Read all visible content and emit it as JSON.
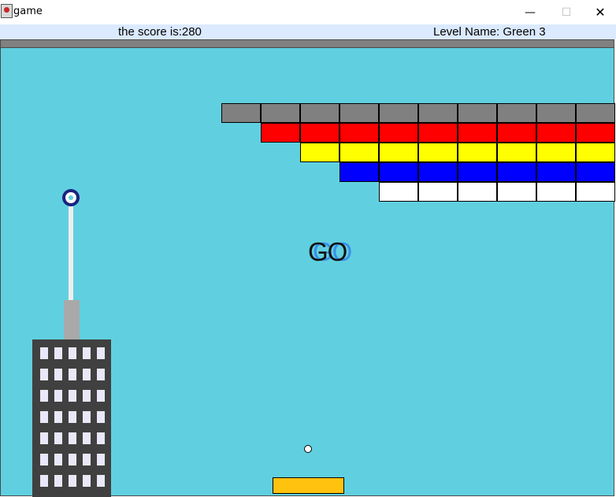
{
  "window": {
    "title": "game",
    "minimize_label": "—",
    "maximize_label": "☐",
    "close_label": "✕"
  },
  "hud": {
    "score_text": "the score is:280",
    "level_text": "Level Name: Green 3"
  },
  "game": {
    "countdown_text": "GO",
    "colors": {
      "background": "#60d0e0",
      "wall": "#808080",
      "paddle": "#ffc20e",
      "ball": "#ffffff"
    },
    "block_rows": [
      {
        "color": "#808080",
        "count": 10
      },
      {
        "color": "#ff0000",
        "count": 9
      },
      {
        "color": "#ffff00",
        "count": 8
      },
      {
        "color": "#0000ff",
        "count": 7
      },
      {
        "color": "#ffffff",
        "count": 6
      }
    ],
    "tower": {
      "window_columns": 5,
      "window_rows": 7
    }
  }
}
